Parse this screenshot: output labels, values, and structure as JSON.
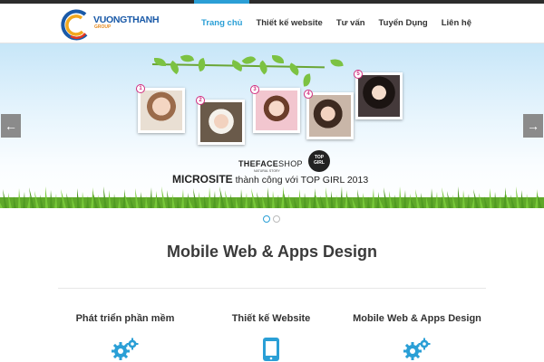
{
  "header": {
    "logo_text": "VUONGTHANH",
    "logo_sub": "GROUP",
    "nav": [
      {
        "label": "Trang chủ",
        "active": true
      },
      {
        "label": "Thiết kế website",
        "active": false
      },
      {
        "label": "Tư vấn",
        "active": false
      },
      {
        "label": "Tuyển Dụng",
        "active": false
      },
      {
        "label": "Liên hệ",
        "active": false
      }
    ]
  },
  "slider": {
    "badges": [
      "1",
      "2",
      "3",
      "4",
      "5"
    ],
    "brand_bold": "THEFACE",
    "brand_rest": "SHOP",
    "brand_sub": "NATURAL STORY",
    "topgirl_line1": "TOP",
    "topgirl_line2": "GIRL",
    "caption_strong": "MICROSITE",
    "caption_rest": " thành công với TOP GIRL 2013",
    "prev_icon": "arrow-left-icon",
    "next_icon": "arrow-right-icon",
    "dots": 2,
    "active_dot": 0
  },
  "main": {
    "title": "Mobile Web & Apps Design",
    "features": [
      {
        "title": "Phát triển phần mềm",
        "icon": "gears-icon"
      },
      {
        "title": "Thiết kế Website",
        "icon": "tablet-icon"
      },
      {
        "title": "Mobile Web & Apps Design",
        "icon": "gears-icon"
      }
    ]
  },
  "colors": {
    "accent": "#2a9fd6",
    "topbar": "#2c2c2c",
    "arrow_bg": "#8b8b8b",
    "badge": "#d02c7e",
    "grass": "#5fa82a"
  }
}
